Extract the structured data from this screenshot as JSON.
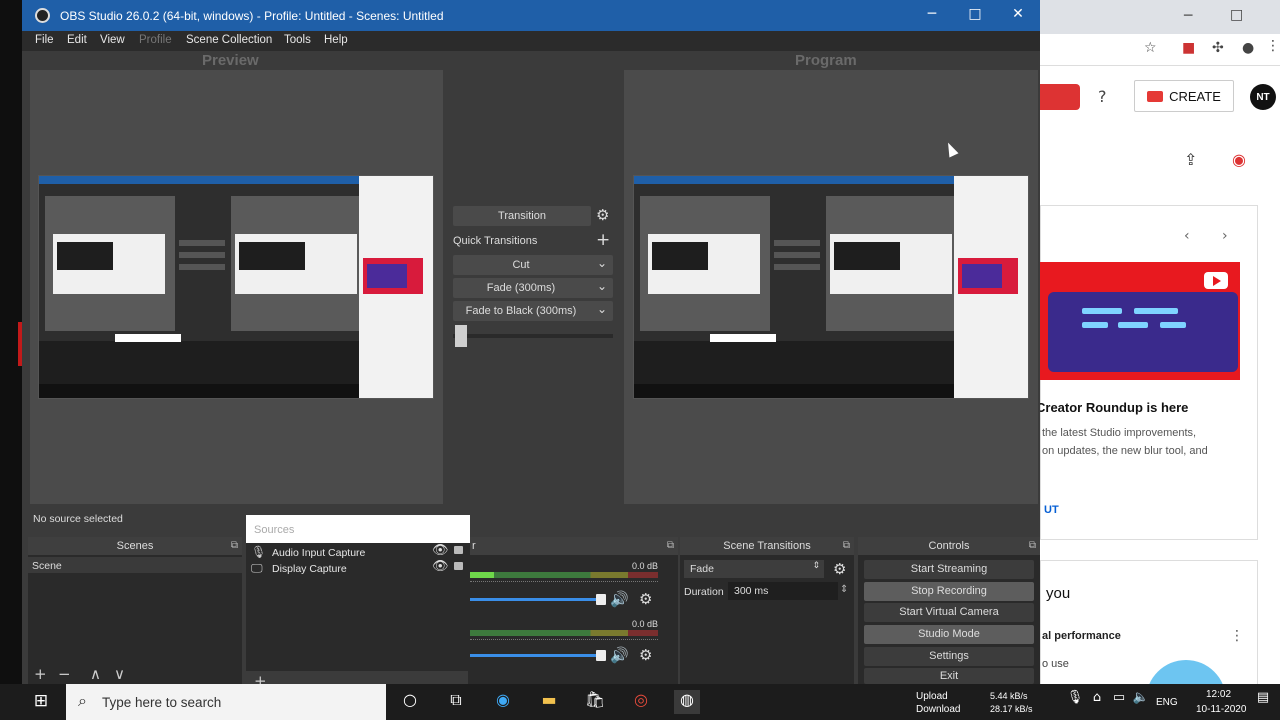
{
  "obs": {
    "title": "OBS Studio 26.0.2 (64-bit, windows) - Profile: Untitled - Scenes: Untitled",
    "menu": [
      "File",
      "Edit",
      "View",
      "Profile",
      "Scene Collection",
      "Tools",
      "Help"
    ],
    "preview_label": "Preview",
    "program_label": "Program",
    "transition_button": "Transition",
    "quick_transitions": "Quick Transitions",
    "quick_items": [
      "Cut",
      "Fade (300ms)",
      "Fade to Black (300ms)"
    ],
    "status": "No source selected",
    "scenes": {
      "header": "Scenes",
      "items": [
        "Scene"
      ]
    },
    "sources": {
      "header": "Sources",
      "items": [
        "Audio Input Capture",
        "Display Capture"
      ]
    },
    "mixer": {
      "header": "r",
      "channels": [
        {
          "db": "0.0 dB",
          "level": 0.13
        },
        {
          "db": "0.0 dB",
          "level": 0.0
        }
      ]
    },
    "scene_transitions": {
      "header": "Scene Transitions",
      "type": "Fade",
      "duration_label": "Duration",
      "duration_value": "300 ms"
    },
    "controls": {
      "header": "Controls",
      "buttons": [
        "Start Streaming",
        "Stop Recording",
        "Start Virtual Camera",
        "Studio Mode",
        "Settings",
        "Exit"
      ]
    }
  },
  "browser": {
    "create_label": "CREATE",
    "avatar_text": "NT",
    "card_title": "Creator Roundup is here",
    "card_lines": [
      "the latest Studio improvements,",
      "on updates, the new blur tool, and"
    ],
    "card_link": "UT",
    "card2_title": "you",
    "card2_sub": "al performance",
    "card2_use": "o use"
  },
  "taskbar": {
    "search_placeholder": "Type here to search",
    "upload_label": "Upload",
    "download_label": "Download",
    "upload_speed": "5.44 kB/s",
    "download_speed": "28.17 kB/s",
    "lang": "ENG",
    "time": "12:02",
    "date": "10-11-2020"
  },
  "colors": {
    "title_bar": "#1f5fa8",
    "obs_bg": "#3b3b3b",
    "slider": "#3a8ee8",
    "yt_red": "#e8191f"
  }
}
